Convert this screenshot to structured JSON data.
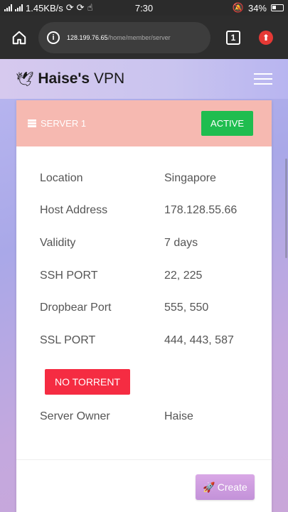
{
  "status_bar": {
    "network_speed": "1.45KB/s",
    "time": "7:30",
    "battery": "34%"
  },
  "browser": {
    "url_host": "128.199.76.65",
    "url_path": "/home/member/server",
    "tab_count": "1"
  },
  "navbar": {
    "brand_bold": "Haise's",
    "brand_rest": " VPN"
  },
  "card": {
    "title": "SERVER 1",
    "status_badge": "ACTIVE",
    "rows": [
      {
        "label": "Location",
        "value": "Singapore"
      },
      {
        "label": "Host Address",
        "value": "178.128.55.66"
      },
      {
        "label": "Validity",
        "value": "7 days"
      },
      {
        "label": "SSH PORT",
        "value": "22, 225"
      },
      {
        "label": "Dropbear Port",
        "value": "555, 550"
      },
      {
        "label": "SSL PORT",
        "value": "444, 443, 587"
      }
    ],
    "torrent_badge": "NO TORRENT",
    "owner_label": "Server Owner",
    "owner_value": "Haise",
    "create_label": "Create"
  },
  "colors": {
    "header_bg": "#f6b9b1",
    "active_green": "#1fbd4f",
    "torrent_red": "#f52c42",
    "create_purple": "#c392d9"
  }
}
